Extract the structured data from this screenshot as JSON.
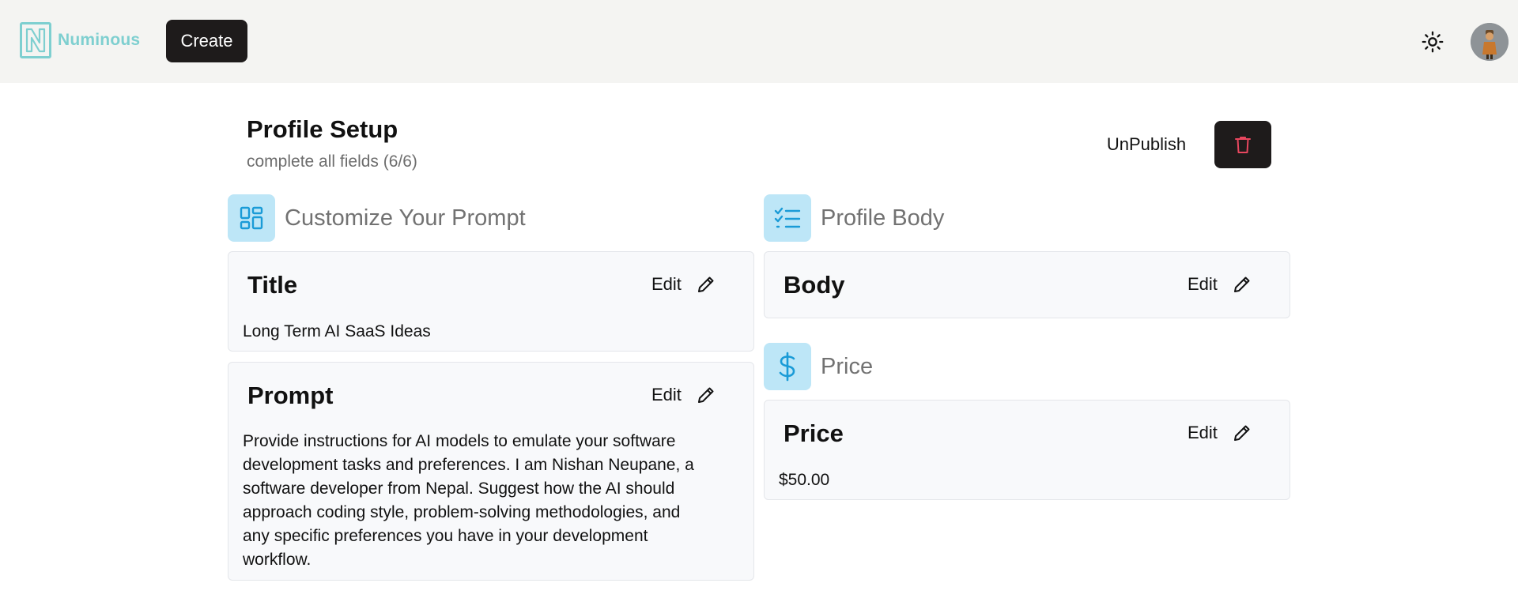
{
  "header": {
    "brand_name": "Numinous",
    "create_label": "Create",
    "icons": {
      "logo": "numinous-logo",
      "theme": "sun-icon",
      "avatar": "user-avatar"
    }
  },
  "page": {
    "title": "Profile Setup",
    "subtitle": "complete all fields (6/6)",
    "unpublish_label": "UnPublish",
    "delete_icon": "trash-icon"
  },
  "sections": {
    "customize": {
      "label": "Customize Your Prompt",
      "icon": "dashboard-grid-icon"
    },
    "profile_body": {
      "label": "Profile Body",
      "icon": "checklist-icon"
    },
    "price": {
      "label": "Price",
      "icon": "dollar-icon"
    }
  },
  "cards": {
    "title": {
      "heading": "Title",
      "edit_label": "Edit",
      "value": "Long Term AI SaaS Ideas"
    },
    "prompt": {
      "heading": "Prompt",
      "edit_label": "Edit",
      "lines": [
        "Provide instructions for AI models to emulate your software",
        "development tasks and preferences. I am Nishan Neupane, a",
        "software developer from Nepal. Suggest how the AI should",
        "approach coding style, problem-solving methodologies, and",
        "any specific preferences you have in your development",
        "workflow."
      ]
    },
    "body": {
      "heading": "Body",
      "edit_label": "Edit"
    },
    "price": {
      "heading": "Price",
      "edit_label": "Edit",
      "value": "$50.00"
    }
  },
  "colors": {
    "brand": "#7ecfd0",
    "header_bg": "#f4f4f2",
    "dark_button": "#1e1b1b",
    "delete_icon": "#e8475f",
    "section_icon_bg": "#bde6f7",
    "section_icon_fg": "#1a9bd7"
  }
}
